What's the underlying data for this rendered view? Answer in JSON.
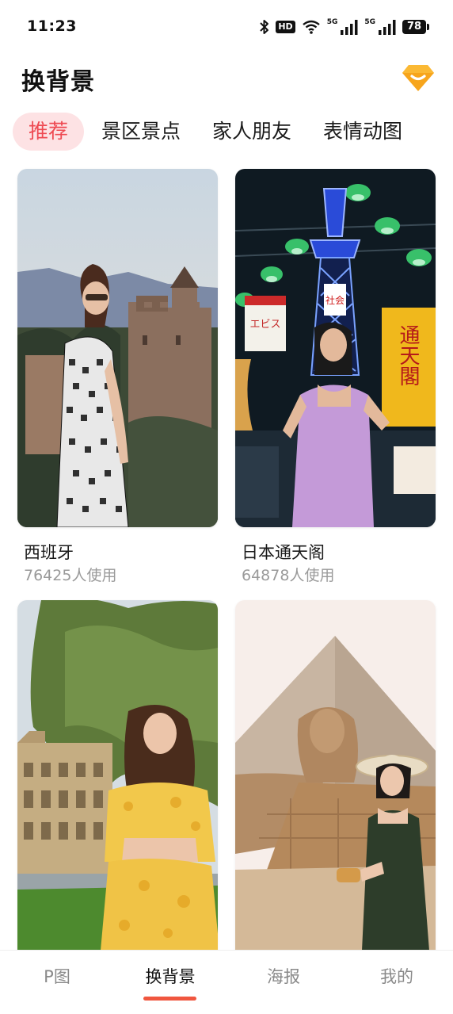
{
  "status_bar": {
    "time": "11:23",
    "icons": [
      "bluetooth-icon",
      "hd-icon",
      "wifi-icon",
      "signal-5g-icon",
      "signal-5g-icon",
      "battery-icon"
    ],
    "hd_label": "HD",
    "net1_label": "5G",
    "net2_label": "5G",
    "battery_level": "78"
  },
  "header": {
    "title": "换背景",
    "vip_icon": "vip-diamond-icon",
    "vip_color": "#f7a51c"
  },
  "tabs": [
    {
      "label": "推荐",
      "active": true
    },
    {
      "label": "景区景点",
      "active": false
    },
    {
      "label": "家人朋友",
      "active": false
    },
    {
      "label": "表情动图",
      "active": false
    }
  ],
  "cards": [
    {
      "title": "西班牙",
      "count": "76425人使用"
    },
    {
      "title": "日本通天阁",
      "count": "64878人使用"
    },
    {
      "title": "",
      "count": ""
    },
    {
      "title": "",
      "count": ""
    }
  ],
  "tower_signs": {
    "sign_left": "エビス",
    "sign_right": "通天閣",
    "sign_top": "社会"
  },
  "bottom_nav": [
    {
      "label": "P图",
      "active": false
    },
    {
      "label": "换背景",
      "active": true
    },
    {
      "label": "海报",
      "active": false
    },
    {
      "label": "我的",
      "active": false
    }
  ],
  "colors": {
    "accent": "#ee4a52",
    "tab_active_bg": "#fde2e4",
    "nav_indicator": "#f0563f"
  }
}
